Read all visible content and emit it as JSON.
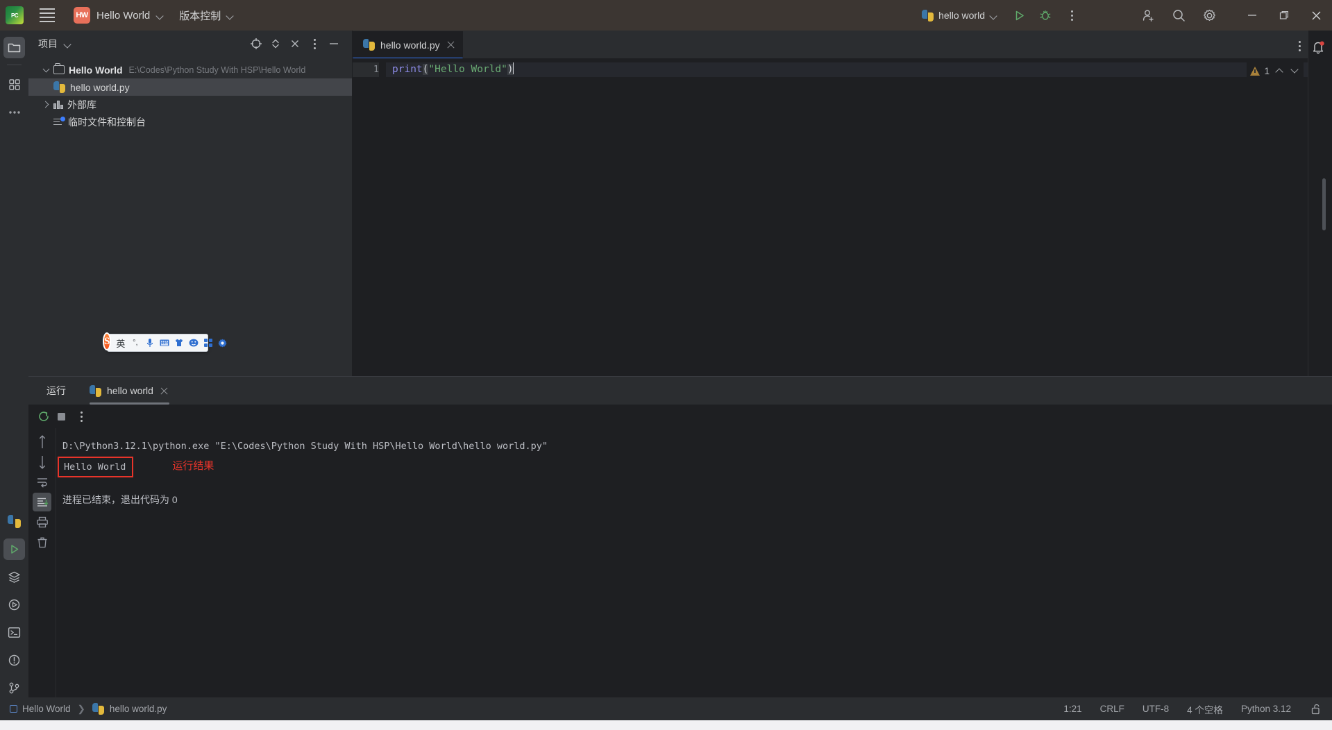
{
  "titlebar": {
    "app_logo": "pycharm-logo",
    "menu_icon": "hamburger-menu-icon",
    "project_badge": "HW",
    "project_name": "Hello World",
    "vcs_label": "版本控制",
    "run_config_name": "hello world",
    "run_icon": "run-triangle-icon",
    "debug_icon": "debug-bug-icon",
    "more_icon": "more-vertical-icon",
    "account_icon": "add-user-icon",
    "search_icon": "search-icon",
    "settings_icon": "gear-icon",
    "minimize_icon": "minimize-icon",
    "maximize_icon": "maximize-icon",
    "close_icon": "close-icon",
    "accent_run_green": "#59a869",
    "badge_color": "#e8705a"
  },
  "rail": {
    "items": [
      {
        "name": "project-tool-window",
        "icon": "folder-icon",
        "active": true
      },
      {
        "name": "structure-tool-window",
        "icon": "grid-squares-icon",
        "active": false
      },
      {
        "name": "more-tool-windows",
        "icon": "ellipsis-icon",
        "active": false
      }
    ],
    "bottom_items": [
      {
        "name": "python-console",
        "icon": "python-icon"
      },
      {
        "name": "run-tool-window",
        "icon": "run-triangle-icon",
        "active": true
      },
      {
        "name": "services-tool-window",
        "icon": "layers-icon"
      },
      {
        "name": "python-packages",
        "icon": "play-circle-icon"
      },
      {
        "name": "terminal-tool-window",
        "icon": "terminal-icon"
      },
      {
        "name": "problems-tool-window",
        "icon": "warning-circle-icon"
      },
      {
        "name": "version-control-tool-window",
        "icon": "git-branch-icon"
      }
    ]
  },
  "project_panel": {
    "title": "项目",
    "title_chevron": "chevron-down-icon",
    "actions": [
      {
        "name": "select-opened-file",
        "icon": "target-crosshair-icon"
      },
      {
        "name": "expand-collapse",
        "icon": "up-down-chevrons-icon"
      },
      {
        "name": "hide-panel",
        "icon": "close-icon"
      },
      {
        "name": "options-menu",
        "icon": "more-vertical-icon"
      },
      {
        "name": "minimize-panel",
        "icon": "minus-icon"
      }
    ],
    "tree": [
      {
        "label": "Hello World",
        "path": "E:\\Codes\\Python Study With HSP\\Hello World",
        "icon": "folder-icon",
        "arrow": "chevron-down-icon",
        "bold": true,
        "selected": false,
        "depth": 0
      },
      {
        "label": "hello world.py",
        "path": "",
        "icon": "python-file-icon",
        "arrow": "",
        "bold": false,
        "selected": true,
        "depth": 1
      },
      {
        "label": "外部库",
        "path": "",
        "icon": "library-icon",
        "arrow": "chevron-right-icon",
        "bold": false,
        "selected": false,
        "depth": 0
      },
      {
        "label": "临时文件和控制台",
        "path": "",
        "icon": "scratches-consoles-icon",
        "arrow": "",
        "bold": false,
        "selected": false,
        "depth": 0
      }
    ]
  },
  "ime_bar": {
    "logo": "S",
    "items": [
      "英",
      "°,",
      "mic-icon",
      "keyboard-icon",
      "skin-icon",
      "emoji-icon",
      "apps-icon",
      "settings-icon"
    ]
  },
  "editor": {
    "tab": {
      "label": "hello world.py",
      "icon": "python-file-icon",
      "close_icon": "close-icon",
      "active_underline_color": "#3574f0"
    },
    "options_icon": "more-vertical-icon",
    "line_number": "1",
    "code": {
      "keyword": "print",
      "open_paren": "(",
      "string": "\"Hello World\"",
      "close_paren": ")"
    },
    "inspection": {
      "warning_icon": "warning-triangle-icon",
      "count": "1",
      "prev_icon": "chevron-up-icon",
      "next_icon": "chevron-down-icon"
    },
    "notification_icon": "bell-icon"
  },
  "run_panel": {
    "title": "运行",
    "tab_label": "hello world",
    "tab_icon": "python-icon",
    "tab_close_icon": "close-icon",
    "toolbar": [
      {
        "name": "rerun-button",
        "icon": "rerun-circular-arrow-icon"
      },
      {
        "name": "stop-button",
        "icon": "stop-square-icon"
      },
      {
        "name": "run-options",
        "icon": "more-vertical-icon"
      }
    ],
    "side_actions": [
      {
        "name": "scroll-up",
        "icon": "arrow-up-icon"
      },
      {
        "name": "scroll-down",
        "icon": "arrow-down-icon"
      },
      {
        "name": "soft-wrap",
        "icon": "soft-wrap-icon"
      },
      {
        "name": "scroll-to-end",
        "icon": "scroll-to-end-icon",
        "active": true
      },
      {
        "name": "print",
        "icon": "printer-icon"
      },
      {
        "name": "clear-all",
        "icon": "trash-icon"
      }
    ],
    "console": {
      "command": "D:\\Python3.12.1\\python.exe \"E:\\Codes\\Python Study With HSP\\Hello World\\hello world.py\"",
      "output": "Hello World",
      "annotation": "运行结果",
      "annotation_color": "#e8342a",
      "exit": "进程已结束，退出代码为 0"
    }
  },
  "statusbar": {
    "breadcrumb_project": "Hello World",
    "breadcrumb_sep": "❯",
    "breadcrumb_file": "hello world.py",
    "breadcrumb_file_icon": "python-file-icon",
    "caret_position": "1:21",
    "line_separator": "CRLF",
    "encoding": "UTF-8",
    "indent": "4 个空格",
    "interpreter": "Python 3.12",
    "lock_icon": "unlocked-padlock-icon"
  }
}
